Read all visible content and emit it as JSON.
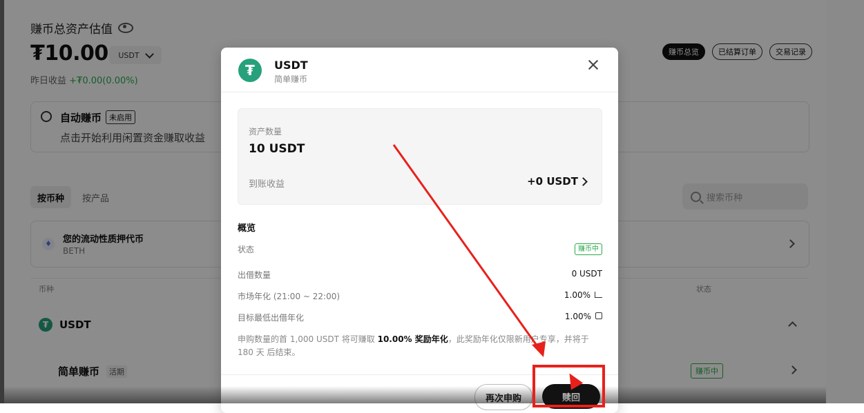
{
  "page": {
    "total_title": "赚币总资产估值",
    "balance": "₮10.00",
    "currency": "USDT",
    "yesterday_prefix": "昨日收益",
    "yesterday_value": "+₮0.00(0.00%)",
    "pills": [
      "赚币总览",
      "已结算订单",
      "交易记录"
    ],
    "auto_earn": {
      "title": "自动赚币",
      "badge": "未启用",
      "desc": "点击开始利用闲置资金赚取收益"
    },
    "filter_tabs": [
      "按币种",
      "按产品"
    ],
    "search_placeholder": "搜索币种",
    "beth": {
      "title": "您的流动性质押代币",
      "sub": "BETH"
    },
    "col_coin": "币种",
    "col_status": "状态",
    "usdt_row": "USDT",
    "simple_earn": "简单赚币",
    "simple_tag": "活期",
    "status_earning": "赚币中"
  },
  "modal": {
    "title": "USDT",
    "subtitle": "简单赚币",
    "asset_label": "资产数量",
    "asset_value": "10 USDT",
    "income_label": "到账收益",
    "income_value": "+0 USDT",
    "overview_title": "概览",
    "rows": [
      {
        "label": "状态",
        "value": "赚币中"
      },
      {
        "label": "出借数量",
        "value": "0 USDT"
      },
      {
        "label": "市场年化 (21:00 ~ 22:00)",
        "value": "1.00%"
      },
      {
        "label": "目标最低出借年化",
        "value": "1.00%"
      }
    ],
    "promo_pre": "申购数量的首 1,000 USDT 将可赚取 ",
    "promo_bold": "10.00% 奖励年化",
    "promo_post": "，此奖励年化仅限新用户专享，并将于 180 天 后结束。",
    "rebuy_button": "再次申购",
    "redeem_button": "赎回"
  },
  "colors": {
    "accent_green": "#2ba84a",
    "usdt_green": "#26a17b",
    "annotation_red": "#e8201b"
  }
}
